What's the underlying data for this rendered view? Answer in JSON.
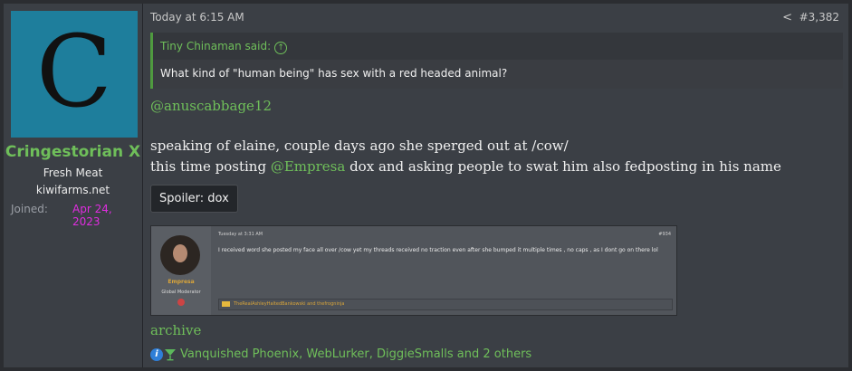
{
  "user": {
    "avatar_letter": "C",
    "username": "Cringestorian X",
    "title": "Fresh Meat",
    "site": "kiwifarms.net",
    "joined_label": "Joined:",
    "joined_value": "Apr 24, 2023"
  },
  "post": {
    "time": "Today at 6:15 AM",
    "number": "#3,382",
    "quote": {
      "author": "Tiny Chinaman said:",
      "text": "What kind of \"human being\" has sex with a red headed animal?"
    },
    "mention": "@anuscabbage12",
    "line1": "speaking of elaine, couple days ago she sperged out at /cow/",
    "line2_pre": "this time posting ",
    "line2_mention": "@Empresa",
    "line2_post": " dox and asking people to swat him also fedposting in his name",
    "spoiler_label": "Spoiler: dox",
    "archive_link": "archive",
    "reactions_text": "Vanquished Phoenix, WebLurker, DiggieSmalls and 2 others"
  },
  "embedded": {
    "time": "Tuesday at 3:31 AM",
    "number": "#934",
    "name": "Empresa",
    "role": "Global Moderator",
    "text": "I received word she posted my face all over /cow yet my threads received no traction even after she bumped it multiple times , no caps , as I dont go on there lol",
    "reactions": "TheRealAshleyHaltedBankowski and thefrogninja"
  }
}
